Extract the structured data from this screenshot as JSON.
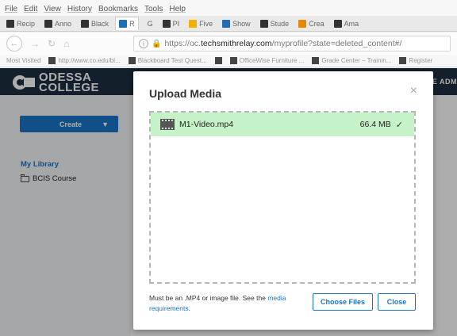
{
  "browser": {
    "menu": [
      "File",
      "Edit",
      "View",
      "History",
      "Bookmarks",
      "Tools",
      "Help"
    ],
    "tabs": [
      {
        "label": "Recip",
        "icon": "dark-square-icon"
      },
      {
        "label": "Anno",
        "icon": "dark-square-icon"
      },
      {
        "label": "Black",
        "icon": "dark-square-icon"
      },
      {
        "label": "R",
        "icon": "r-logo-icon"
      },
      {
        "label": "G",
        "icon": "google-icon"
      },
      {
        "label": "PI",
        "icon": "pi-icon"
      },
      {
        "label": "Five",
        "icon": "microsoft-icon"
      },
      {
        "label": "Show",
        "icon": "blue-square-icon"
      },
      {
        "label": "Stude",
        "icon": "star-icon"
      },
      {
        "label": "Crea",
        "icon": "orange-square-icon"
      },
      {
        "label": "Ama",
        "icon": "amazon-icon"
      }
    ],
    "url": {
      "prefix": "https://oc.",
      "host": "techsmithrelay.com",
      "path": "/myprofile?state=deleted_content#/"
    },
    "bookmarks": [
      "Most Visited",
      "http://www.co.edu/bl...",
      "Blackboard Test Quest...",
      "OfficeWise Furniture ...",
      "Grade Center – Trainin...",
      "Register"
    ]
  },
  "site": {
    "logo_line1": "ODESSA",
    "logo_line2": "COLLEGE",
    "header_right": "E ADM"
  },
  "sidebar": {
    "create_label": "Create",
    "library_title": "My Library",
    "items": [
      {
        "label": "BCIS Course"
      }
    ]
  },
  "modal": {
    "title": "Upload Media",
    "close_symbol": "×",
    "file": {
      "name": "M1-Video.mp4",
      "size": "66.4 MB",
      "status_symbol": "✓"
    },
    "note_text": "Must be an .MP4 or image file. See the ",
    "note_link": "media requirements",
    "note_end": ".",
    "choose_label": "Choose Files",
    "close_label": "Close"
  },
  "colors": {
    "accent": "#1a75c9",
    "header_bg": "#1c2f3f",
    "file_row_bg": "#c6f2c8"
  }
}
